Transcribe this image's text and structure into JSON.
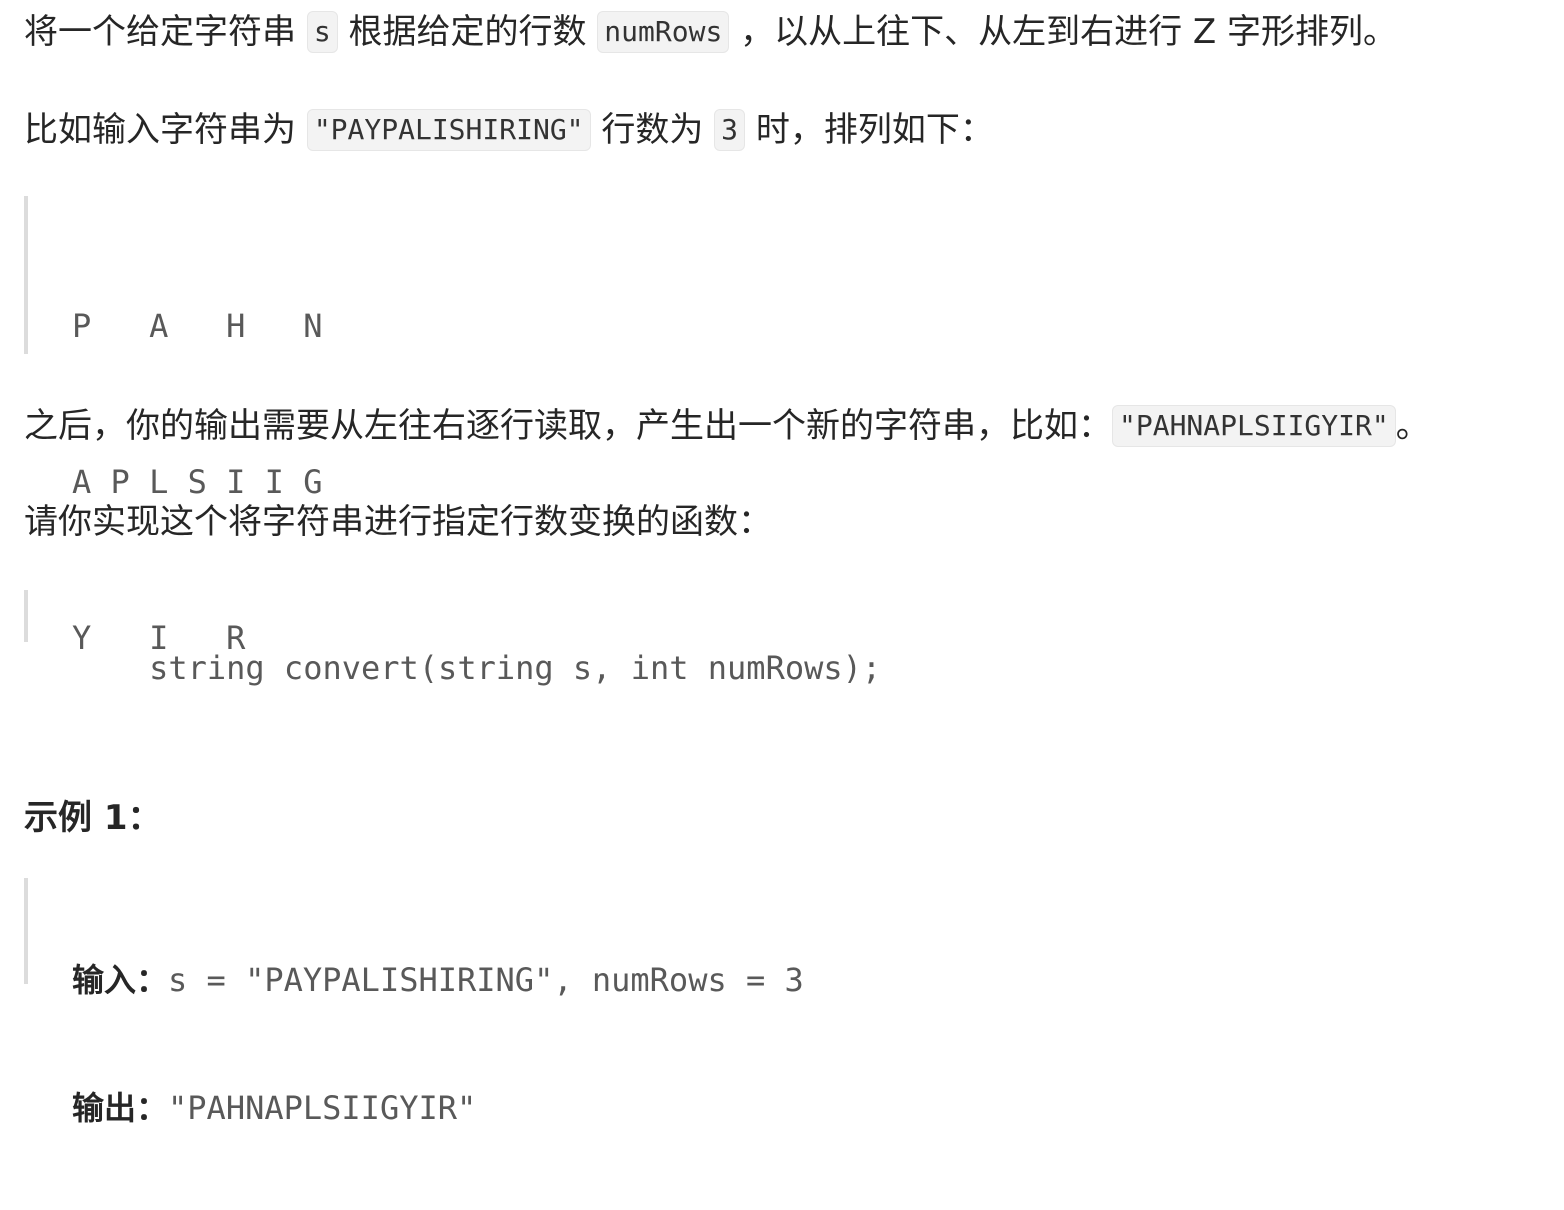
{
  "intro": {
    "part1": "将一个给定字符串 ",
    "code_s": "s",
    "part2": " 根据给定的行数 ",
    "code_numrows": "numRows",
    "part3": " ，以从上往下、从左到右进行 Z 字形排列。"
  },
  "example_intro": {
    "part1": "比如输入字符串为 ",
    "code_input": "\"PAYPALISHIRING\"",
    "part2": " 行数为 ",
    "code_rows": "3",
    "part3": " 时，排列如下："
  },
  "zigzag": {
    "rows": [
      "P   A   H   N",
      "A P L S I I G",
      "Y   I   R"
    ]
  },
  "output_intro": {
    "part1": "之后，你的输出需要从左往右逐行读取，产生出一个新的字符串，比如：",
    "code_output": "\"PAHNAPLSIIGYIR\"",
    "part2": "。"
  },
  "function_intro": {
    "text": "请你实现这个将字符串进行指定行数变换的函数："
  },
  "signature": {
    "code": "string convert(string s, int numRows);"
  },
  "example1": {
    "heading": "示例 1：",
    "input_label": "输入：",
    "input_value": "s = \"PAYPALISHIRING\", numRows = 3",
    "output_label": "输出：",
    "output_value": "\"PAHNAPLSIIGYIR\""
  }
}
